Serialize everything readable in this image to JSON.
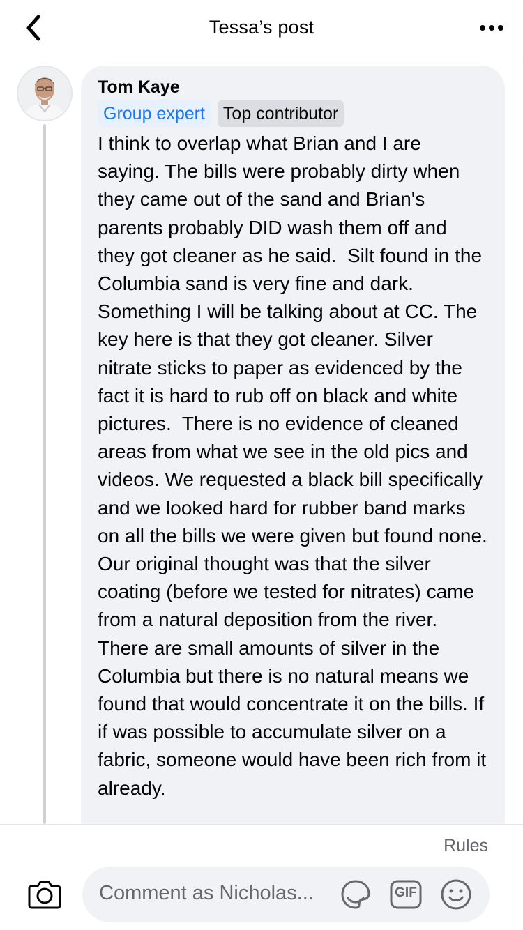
{
  "header": {
    "title": "Tessa’s post",
    "back_icon": "chevron-left-icon",
    "more_icon": "more-horizontal-icon"
  },
  "comment": {
    "author": "Tom Kaye",
    "badges": [
      "Group expert",
      "Top contributor"
    ],
    "text": "I think to overlap what Brian and I are saying. The bills were probably dirty when they came out of the sand and Brian's parents probably DID wash them off and they got cleaner as he said.  Silt found in the Columbia sand is very fine and dark. Something I will be talking about at CC. The key here is that they got cleaner. Silver nitrate sticks to paper as evidenced by the fact it is hard to rub off on black and white pictures.  There is no evidence of cleaned areas from what we see in the old pics and videos. We requested a black bill specifically and we looked hard for rubber band marks on all the bills we were given but found none. Our original thought was that the silver coating (before we tested for nitrates) came from a natural deposition from the river. There are small amounts of silver in the Columbia but there is no natural means we found that would concentrate it on the bills. If if was possible to accumulate silver on a fabric, someone would have been rich from it already."
  },
  "footer": {
    "rules_label": "Rules",
    "comment_placeholder": "Comment as Nicholas...",
    "gif_label": "GIF"
  },
  "colors": {
    "accent": "#1877f2",
    "bubble": "#f0f2f5",
    "secondary_text": "#65676b"
  }
}
